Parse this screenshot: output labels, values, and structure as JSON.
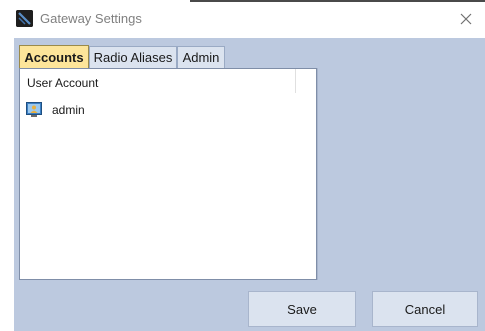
{
  "window": {
    "title": "Gateway Settings",
    "close_symbol": "✕",
    "app_icon": "gateway-app-icon"
  },
  "tabs": [
    {
      "label": "Accounts",
      "active": true
    },
    {
      "label": "Radio Aliases",
      "active": false
    },
    {
      "label": "Admin",
      "active": false
    }
  ],
  "accounts": {
    "column_header": "User Account",
    "items": [
      {
        "label": "admin",
        "icon": "user-account-icon"
      }
    ]
  },
  "buttons": {
    "save_label": "Save",
    "cancel_label": "Cancel"
  },
  "colors": {
    "panel_background": "#bcc9df",
    "active_tab": "#fde59a",
    "button_background": "#dbe3ef"
  }
}
